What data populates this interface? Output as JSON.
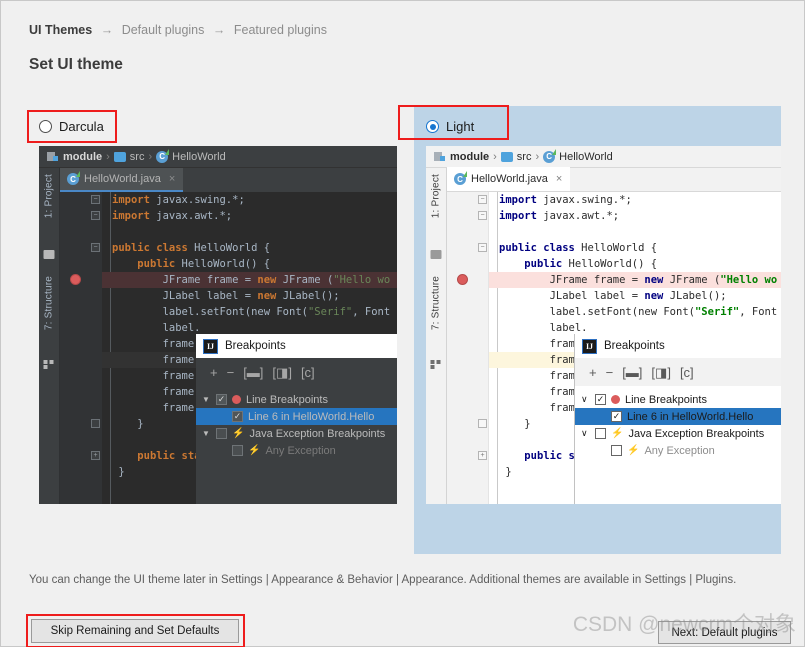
{
  "header": {
    "breadcrumb": [
      {
        "label": "UI Themes",
        "active": true
      },
      {
        "label": "Default plugins",
        "active": false
      },
      {
        "label": "Featured plugins",
        "active": false
      }
    ],
    "separator": "→",
    "title": "Set UI theme"
  },
  "themes": {
    "darcula": {
      "label": "Darcula",
      "selected": false
    },
    "light": {
      "label": "Light",
      "selected": true
    }
  },
  "preview": {
    "breadcrumb": {
      "module": "module",
      "src": "src",
      "class": "HelloWorld",
      "chevron": "›"
    },
    "tab": {
      "label": "HelloWorld.java",
      "close": "×"
    },
    "rails": {
      "project": "1: Project",
      "structure": "7: Structure"
    },
    "code_lines": [
      {
        "fold": "minus",
        "tokens": [
          {
            "t": "kw",
            "v": "import"
          },
          {
            "t": "txt",
            "v": " javax.swing.*;"
          }
        ]
      },
      {
        "fold": "minus",
        "tokens": [
          {
            "t": "kw",
            "v": "import"
          },
          {
            "t": "txt",
            "v": " javax.awt.*;"
          }
        ]
      },
      {
        "fold": "",
        "tokens": []
      },
      {
        "fold": "minus",
        "tokens": [
          {
            "t": "kw",
            "v": "public class"
          },
          {
            "t": "txt",
            "v": " HelloWorld {"
          }
        ]
      },
      {
        "fold": "",
        "indent": 4,
        "tokens": [
          {
            "t": "kw",
            "v": "public"
          },
          {
            "t": "txt",
            "v": " HelloWorld() {"
          }
        ]
      },
      {
        "fold": "",
        "indent": 8,
        "breakpoint": true,
        "tokens": [
          {
            "t": "txt",
            "v": "JFrame frame = "
          },
          {
            "t": "kw",
            "v": "new"
          },
          {
            "t": "txt",
            "v": " JFrame ("
          },
          {
            "t": "str",
            "v": "\"Hello wo"
          }
        ]
      },
      {
        "fold": "",
        "indent": 8,
        "tokens": [
          {
            "t": "txt",
            "v": "JLabel label = "
          },
          {
            "t": "kw",
            "v": "new"
          },
          {
            "t": "txt",
            "v": " JLabel();"
          }
        ]
      },
      {
        "fold": "",
        "indent": 8,
        "tokens": [
          {
            "t": "txt",
            "v": "label.setFont(new Font("
          },
          {
            "t": "str",
            "v": "\"Serif\""
          },
          {
            "t": "txt",
            "v": ", Font"
          }
        ]
      },
      {
        "fold": "",
        "indent": 8,
        "tokens": [
          {
            "t": "txt",
            "v": "label."
          }
        ]
      },
      {
        "fold": "",
        "indent": 8,
        "tokens": [
          {
            "t": "txt",
            "v": "frame."
          }
        ]
      },
      {
        "fold": "",
        "indent": 8,
        "current": true,
        "tokens": [
          {
            "t": "txt",
            "v": "frame."
          }
        ]
      },
      {
        "fold": "",
        "indent": 8,
        "tokens": [
          {
            "t": "txt",
            "v": "frame."
          }
        ]
      },
      {
        "fold": "",
        "indent": 8,
        "tokens": [
          {
            "t": "txt",
            "v": "frame."
          }
        ]
      },
      {
        "fold": "",
        "indent": 8,
        "tokens": [
          {
            "t": "txt",
            "v": "frame."
          }
        ]
      },
      {
        "fold": "end",
        "indent": 4,
        "tokens": [
          {
            "t": "txt",
            "v": "}"
          }
        ]
      },
      {
        "fold": "",
        "tokens": []
      },
      {
        "fold": "plus",
        "indent": 4,
        "tokens": [
          {
            "t": "kw",
            "v": "public sta"
          }
        ]
      },
      {
        "fold": "",
        "indent": 1,
        "tokens": [
          {
            "t": "txt",
            "v": "}"
          }
        ]
      }
    ]
  },
  "breakpoints_dialog": {
    "title": "Breakpoints",
    "logo": "IJ",
    "toolbar": [
      {
        "name": "add-breakpoint-button",
        "glyph": "+"
      },
      {
        "name": "remove-breakpoint-button",
        "glyph": "−"
      },
      {
        "name": "group-by-file-button",
        "glyph": "[▬]"
      },
      {
        "name": "group-by-package-button",
        "glyph": "[◨]"
      },
      {
        "name": "group-by-class-button",
        "glyph": "[c]"
      }
    ],
    "tree": [
      {
        "name": "line-breakpoints-group",
        "level": 0,
        "expander": "collapse",
        "checked": true,
        "icon": "red-dot",
        "label": "Line Breakpoints",
        "selected": false,
        "dim": false
      },
      {
        "name": "line-breakpoint-item",
        "level": 1,
        "expander": "none",
        "checked": true,
        "icon": "none",
        "label": "Line 6 in HelloWorld.Hello",
        "selected": true,
        "dim": false
      },
      {
        "name": "java-exception-breakpoints-group",
        "level": 0,
        "expander": "collapse",
        "checked": false,
        "icon": "bolt",
        "label": "Java Exception Breakpoints",
        "selected": false,
        "dim": false
      },
      {
        "name": "any-exception-item",
        "level": 1,
        "expander": "none",
        "checked": false,
        "icon": "bolt-dim",
        "label": "Any Exception",
        "selected": false,
        "dim": true
      }
    ]
  },
  "footer": {
    "help_text": "You can change the UI theme later in Settings | Appearance & Behavior | Appearance. Additional themes are available in Settings | Plugins.",
    "skip_button": "Skip Remaining and Set Defaults",
    "next_button": "Next: Default plugins"
  },
  "watermark": "CSDN @newcrm个对象",
  "colors": {
    "page_bg": "#f0f0f0",
    "accent_selection": "#bdd4e7",
    "annotation_red": "#ee1c1c",
    "tree_selection_blue": "#2675bf",
    "dark_editor_bg": "#2b2b2b",
    "dark_chrome_bg": "#3c3f41",
    "light_editor_bg": "#ffffff"
  }
}
